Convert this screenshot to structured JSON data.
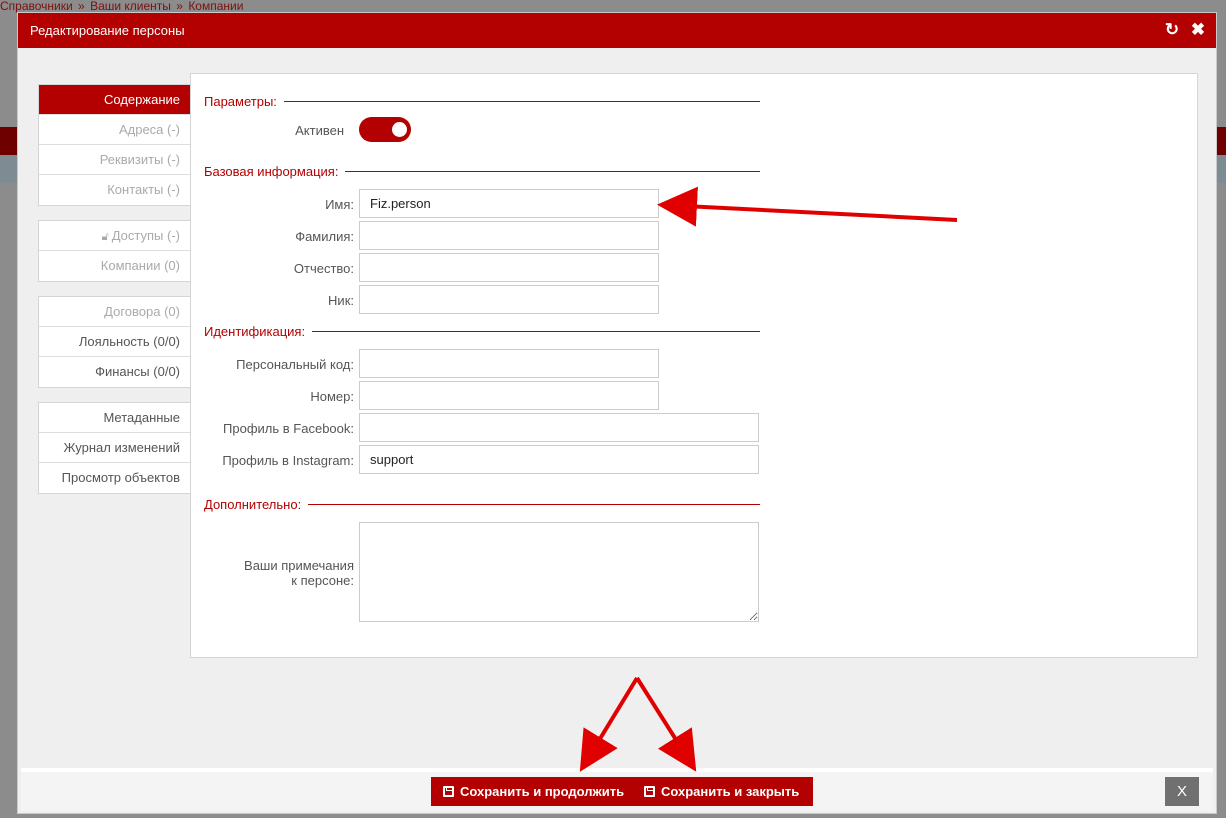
{
  "background": {
    "breadcrumb": [
      "Справочники",
      "»",
      "Ваши клиенты",
      "»",
      "Компании"
    ]
  },
  "modal": {
    "title": "Редактирование персоны",
    "icons": [
      "refresh-icon",
      "close-icon"
    ]
  },
  "sidebar": {
    "groups": [
      [
        {
          "label": "Содержание",
          "state": "active"
        },
        {
          "label": "Адреса (-)",
          "state": "disabled"
        },
        {
          "label": "Реквизиты (-)",
          "state": "disabled"
        },
        {
          "label": "Контакты (-)",
          "state": "disabled"
        }
      ],
      [
        {
          "label": "Доступы (-)",
          "state": "disabled",
          "icon": "lock-icon"
        },
        {
          "label": "Компании (0)",
          "state": "disabled"
        }
      ],
      [
        {
          "label": "Договора (0)",
          "state": "disabled"
        },
        {
          "label": "Лояльность (0/0)",
          "state": "normal"
        },
        {
          "label": "Финансы (0/0)",
          "state": "normal"
        }
      ],
      [
        {
          "label": "Метаданные",
          "state": "normal"
        },
        {
          "label": "Журнал изменений",
          "state": "normal"
        },
        {
          "label": "Просмотр объектов",
          "state": "normal"
        }
      ]
    ]
  },
  "form": {
    "sections": {
      "params": "Параметры:",
      "basic": "Базовая информация:",
      "ident": "Идентификация:",
      "extra": "Дополнительно:"
    },
    "active": {
      "label": "Активен",
      "value": true
    },
    "first_name": {
      "label": "Имя:",
      "value": "Fiz.person"
    },
    "last_name": {
      "label": "Фамилия:",
      "value": ""
    },
    "patronymic": {
      "label": "Отчество:",
      "value": ""
    },
    "nick": {
      "label": "Ник:",
      "value": ""
    },
    "personal_code": {
      "label": "Персональный код:",
      "value": ""
    },
    "number": {
      "label": "Номер:",
      "value": ""
    },
    "facebook": {
      "label": "Профиль в Facebook:",
      "value": ""
    },
    "instagram": {
      "label": "Профиль в Instagram:",
      "value": "support"
    },
    "notes": {
      "label_line1": "Ваши примечания",
      "label_line2": "к персоне:",
      "value": ""
    }
  },
  "footer": {
    "save_continue": "Сохранить и продолжить",
    "save_close": "Сохранить и закрыть",
    "close": "X"
  },
  "colors": {
    "accent": "#b30000",
    "annotation": "#e00000"
  }
}
